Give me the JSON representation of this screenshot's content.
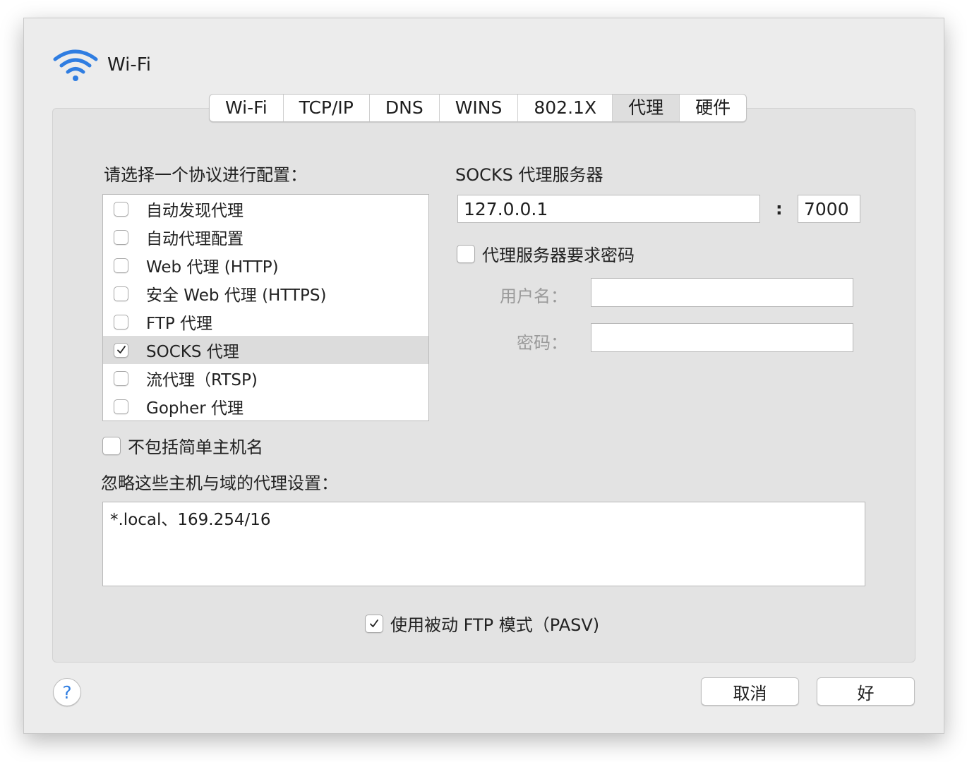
{
  "header": {
    "title": "Wi-Fi",
    "icon": "wifi-icon",
    "accent_color": "#2f7de1"
  },
  "tabs": [
    {
      "label": "Wi-Fi",
      "selected": false
    },
    {
      "label": "TCP/IP",
      "selected": false
    },
    {
      "label": "DNS",
      "selected": false
    },
    {
      "label": "WINS",
      "selected": false
    },
    {
      "label": "802.1X",
      "selected": false
    },
    {
      "label": "代理",
      "selected": true
    },
    {
      "label": "硬件",
      "selected": false
    }
  ],
  "protocols": {
    "label": "请选择一个协议进行配置：",
    "items": [
      {
        "label": "自动发现代理",
        "checked": false
      },
      {
        "label": "自动代理配置",
        "checked": false
      },
      {
        "label": "Web 代理 (HTTP)",
        "checked": false
      },
      {
        "label": "安全 Web 代理 (HTTPS)",
        "checked": false
      },
      {
        "label": "FTP 代理",
        "checked": false
      },
      {
        "label": "SOCKS 代理",
        "checked": true,
        "selected": true
      },
      {
        "label": "流代理（RTSP)",
        "checked": false
      },
      {
        "label": "Gopher 代理",
        "checked": false
      }
    ]
  },
  "socks": {
    "title": "SOCKS 代理服务器",
    "server": "127.0.0.1",
    "separator": ":",
    "port": "7000",
    "requires_password_label": "代理服务器要求密码",
    "requires_password": false,
    "username_label": "用户名：",
    "username": "",
    "password_label": "密码：",
    "password": ""
  },
  "exclude_simple": {
    "label": "不包括简单主机名",
    "checked": false
  },
  "bypass": {
    "label": "忽略这些主机与域的代理设置：",
    "value": "*.local、169.254/16"
  },
  "pasv": {
    "label": "使用被动 FTP 模式（PASV)",
    "checked": true
  },
  "footer": {
    "help_label": "?",
    "cancel_label": "取消",
    "ok_label": "好"
  }
}
